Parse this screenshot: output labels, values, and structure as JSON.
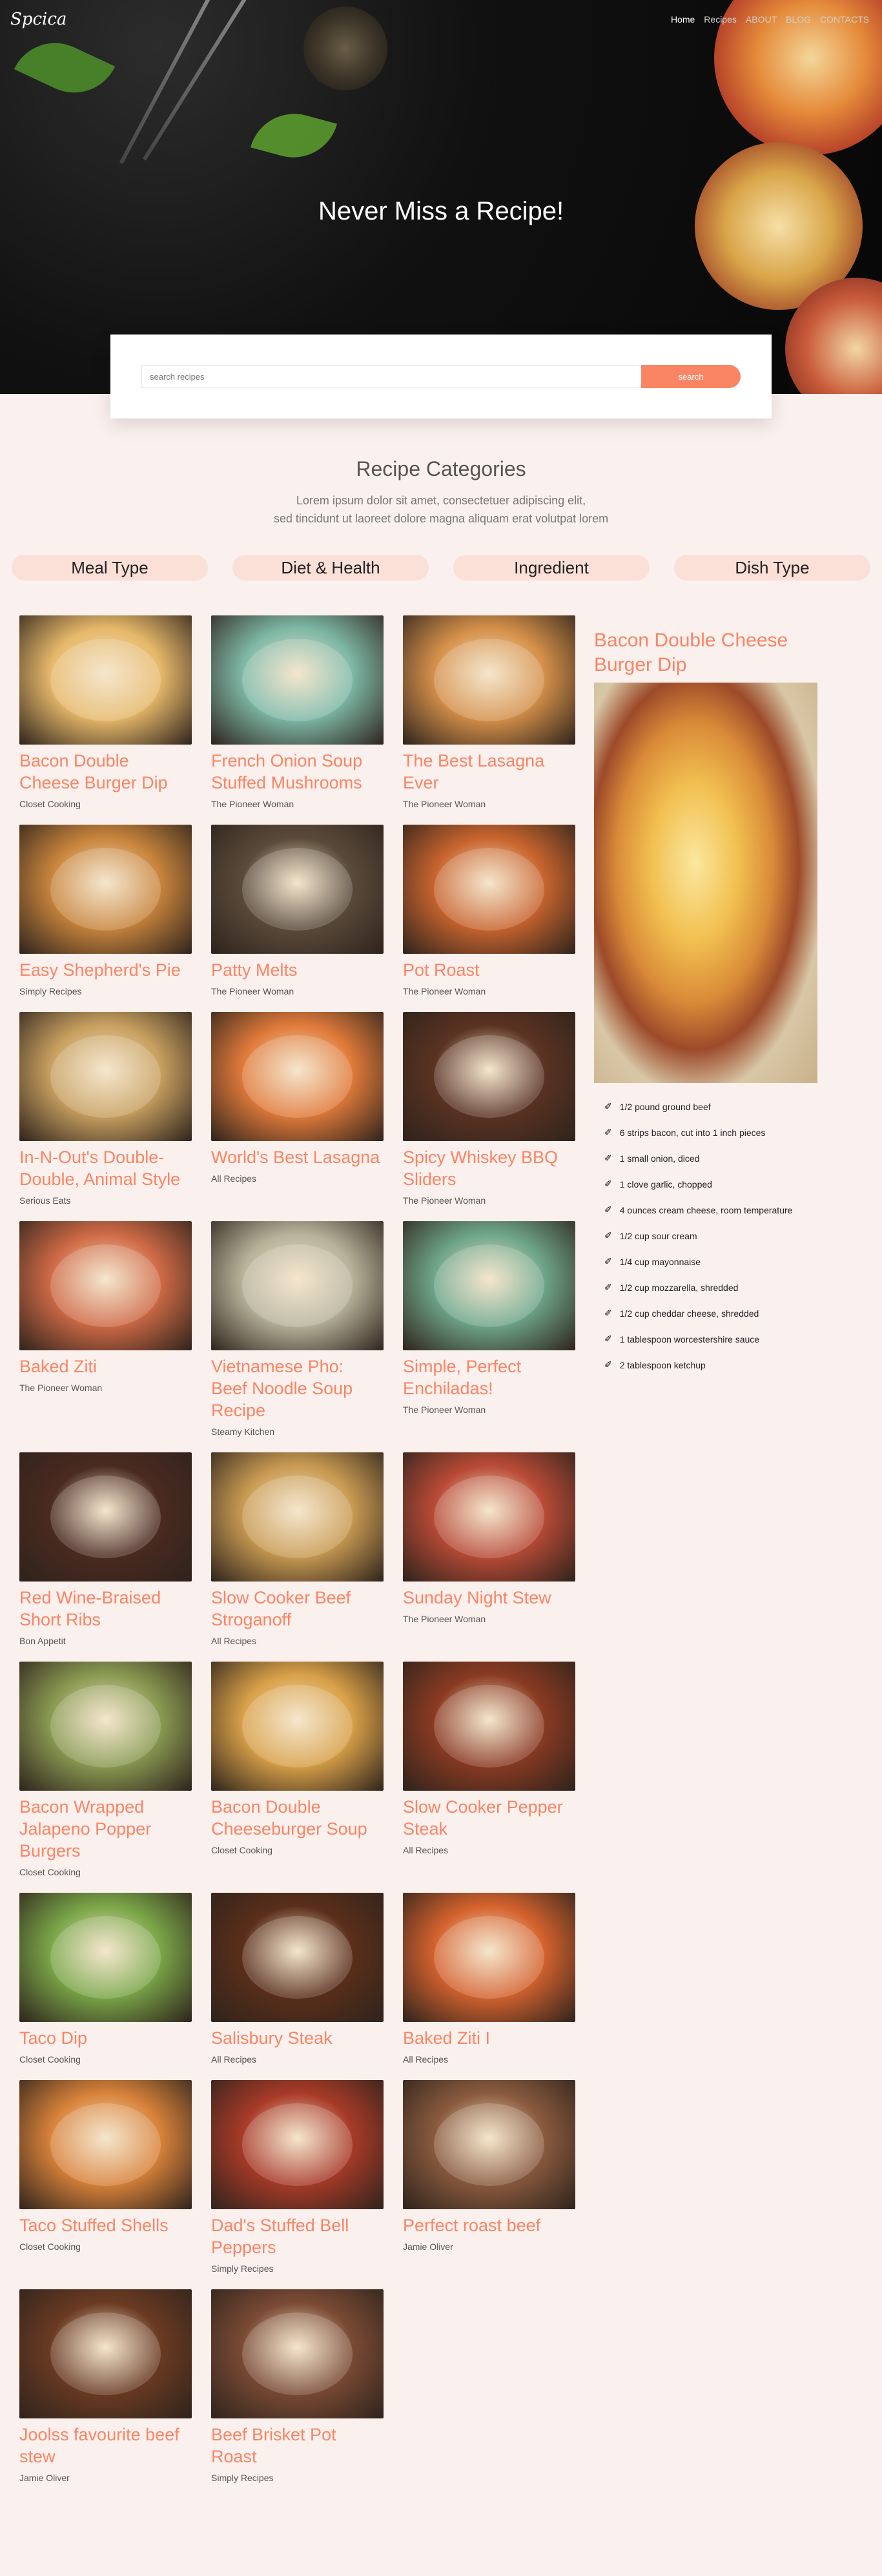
{
  "brand": "Spcica",
  "nav": [
    "Home",
    "Recipes",
    "ABOUT",
    "BLOG",
    "CONTACTS"
  ],
  "hero_title": "Never Miss a Recipe!",
  "search": {
    "placeholder": "search recipes",
    "button": "search"
  },
  "categories": {
    "title": "Recipe Categories",
    "line1": "Lorem ipsum dolor sit amet, consectetuer adipiscing elit,",
    "line2": "sed tincidunt ut laoreet dolore magna aliquam erat volutpat lorem",
    "tabs": [
      "Meal Type",
      "Diet & Health",
      "Ingredient",
      "Dish Type"
    ]
  },
  "recipes": [
    {
      "title": "Bacon Double Cheese Burger Dip",
      "source": "Closet Cooking",
      "color": "#e6b86a"
    },
    {
      "title": "French Onion Soup Stuffed Mushrooms",
      "source": "The Pioneer Woman",
      "color": "#7eb8a6"
    },
    {
      "title": "The Best Lasagna Ever",
      "source": "The Pioneer Woman",
      "color": "#d5904a"
    },
    {
      "title": "Easy Shepherd's Pie",
      "source": "Simply Recipes",
      "color": "#c8843c"
    },
    {
      "title": "Patty Melts",
      "source": "The Pioneer Woman",
      "color": "#5a4a3a"
    },
    {
      "title": "Pot Roast",
      "source": "The Pioneer Woman",
      "color": "#c8642e"
    },
    {
      "title": "In-N-Out's Double-Double, Animal Style",
      "source": "Serious Eats",
      "color": "#c8a060"
    },
    {
      "title": "World's Best Lasagna",
      "source": "All Recipes",
      "color": "#e07a3a"
    },
    {
      "title": "Spicy Whiskey BBQ Sliders",
      "source": "The Pioneer Woman",
      "color": "#5a3222"
    },
    {
      "title": "Baked Ziti",
      "source": "The Pioneer Woman",
      "color": "#cf6a46"
    },
    {
      "title": "Vietnamese Pho: Beef Noodle Soup Recipe",
      "source": "Steamy Kitchen",
      "color": "#b8b29a"
    },
    {
      "title": "Simple, Perfect Enchiladas!",
      "source": "The Pioneer Woman",
      "color": "#6fa68a"
    },
    {
      "title": "Red Wine-Braised Short Ribs",
      "source": "Bon Appetit",
      "color": "#4a2a20"
    },
    {
      "title": "Slow Cooker Beef Stroganoff",
      "source": "All Recipes",
      "color": "#c89a52"
    },
    {
      "title": "Sunday Night Stew",
      "source": "The Pioneer Woman",
      "color": "#b84a36"
    },
    {
      "title": "Bacon Wrapped Jalapeno Popper Burgers",
      "source": "Closet Cooking",
      "color": "#8a9a52"
    },
    {
      "title": "Bacon Double Cheeseburger Soup",
      "source": "Closet Cooking",
      "color": "#d8a048"
    },
    {
      "title": "Slow Cooker Pepper Steak",
      "source": "All Recipes",
      "color": "#8a3a22"
    },
    {
      "title": "Taco Dip",
      "source": "Closet Cooking",
      "color": "#7aa648"
    },
    {
      "title": "Salisbury Steak",
      "source": "All Recipes",
      "color": "#5a2e1a"
    },
    {
      "title": "Baked Ziti I",
      "source": "All Recipes",
      "color": "#d4622e"
    },
    {
      "title": "Taco Stuffed Shells",
      "source": "Closet Cooking",
      "color": "#d8823a"
    },
    {
      "title": "Dad's Stuffed Bell Peppers",
      "source": "Simply Recipes",
      "color": "#a83a28"
    },
    {
      "title": "Perfect roast beef",
      "source": "Jamie Oliver",
      "color": "#8a5a3e"
    },
    {
      "title": "Joolss favourite beef stew",
      "source": "Jamie Oliver",
      "color": "#6a3a22"
    },
    {
      "title": "Beef Brisket Pot Roast",
      "source": "Simply Recipes",
      "color": "#7a4a34"
    }
  ],
  "detail": {
    "title": "Bacon Double Cheese Burger Dip",
    "ingredients": [
      "1/2 pound ground beef",
      "6 strips bacon, cut into 1 inch pieces",
      "1 small onion, diced",
      "1 clove garlic, chopped",
      "4 ounces cream cheese, room temperature",
      "1/2 cup sour cream",
      "1/4 cup mayonnaise",
      "1/2 cup mozzarella, shredded",
      "1/2 cup cheddar cheese, shredded",
      "1 tablespoon worcestershire sauce",
      "2 tablespoon ketchup"
    ]
  }
}
